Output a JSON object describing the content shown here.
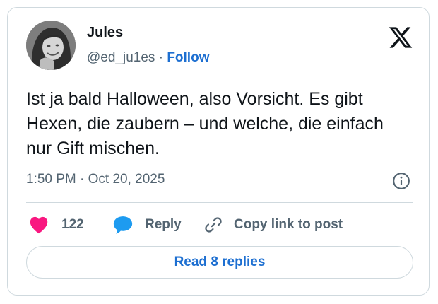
{
  "author": {
    "name": "Jules",
    "handle": "@ed_ju1es",
    "separator": "·",
    "follow_label": "Follow"
  },
  "brand": {
    "icon": "x-logo-icon"
  },
  "tweet": {
    "text": "Ist ja bald Halloween, also Vorsicht. Es gibt Hexen, die zaubern – und welche, die einfach nur Gift mischen.",
    "timestamp": "1:50 PM · Oct 20, 2025"
  },
  "actions": {
    "likes_count": "122",
    "reply_label": "Reply",
    "copy_label": "Copy link to post"
  },
  "footer": {
    "read_replies_label": "Read 8 replies"
  },
  "colors": {
    "like": "#f91880",
    "reply": "#1d9bf0",
    "link": "#1d6fd1",
    "muted": "#536471",
    "text": "#0f1419",
    "border": "#cfd9de"
  }
}
